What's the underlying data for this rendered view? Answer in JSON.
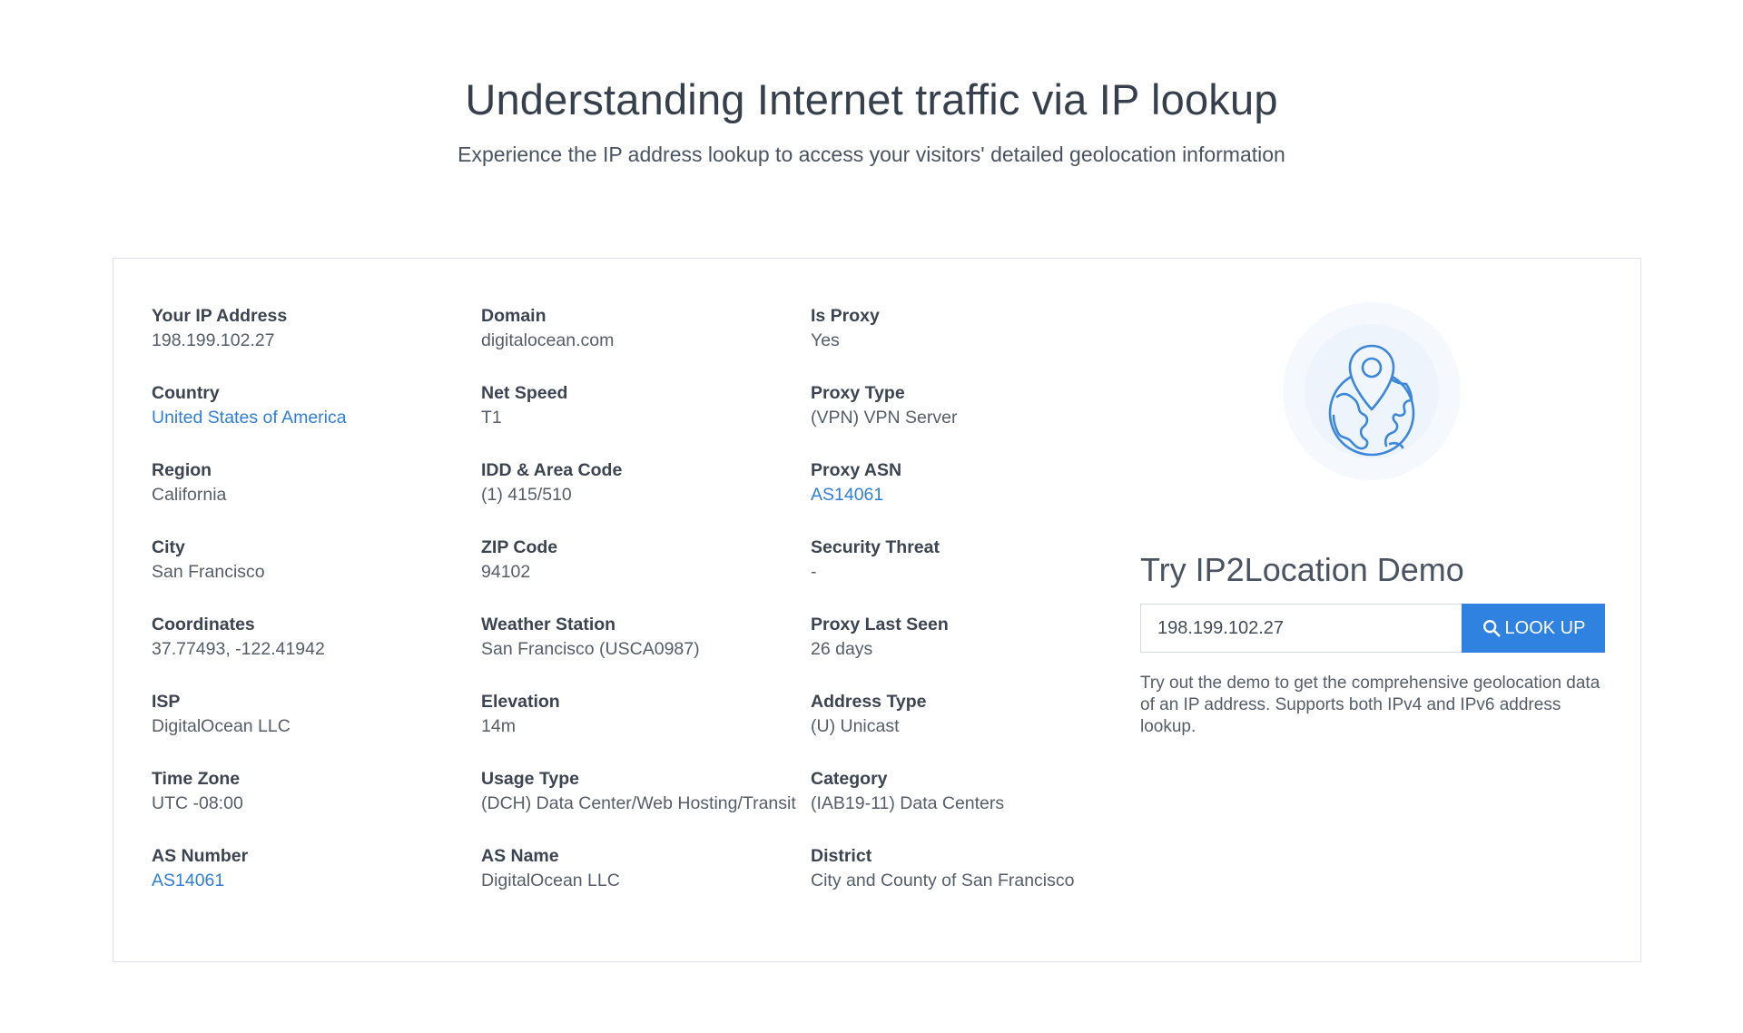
{
  "hero": {
    "title": "Understanding Internet traffic via IP lookup",
    "subtitle": "Experience the IP address lookup to access your visitors' detailed geolocation information"
  },
  "columns": [
    [
      {
        "label": "Your IP Address",
        "value": "198.199.102.27",
        "link": false
      },
      {
        "label": "Country",
        "value": "United States of America",
        "link": true
      },
      {
        "label": "Region",
        "value": "California",
        "link": false
      },
      {
        "label": "City",
        "value": "San Francisco",
        "link": false
      },
      {
        "label": "Coordinates",
        "value": "37.77493, -122.41942",
        "link": false
      },
      {
        "label": "ISP",
        "value": "DigitalOcean LLC",
        "link": false
      },
      {
        "label": "Time Zone",
        "value": "UTC -08:00",
        "link": false
      },
      {
        "label": "AS Number",
        "value": "AS14061",
        "link": true
      }
    ],
    [
      {
        "label": "Domain",
        "value": "digitalocean.com",
        "link": false
      },
      {
        "label": "Net Speed",
        "value": "T1",
        "link": false
      },
      {
        "label": "IDD & Area Code",
        "value": "(1) 415/510",
        "link": false
      },
      {
        "label": "ZIP Code",
        "value": "94102",
        "link": false
      },
      {
        "label": "Weather Station",
        "value": "San Francisco (USCA0987)",
        "link": false
      },
      {
        "label": "Elevation",
        "value": "14m",
        "link": false
      },
      {
        "label": "Usage Type",
        "value": "(DCH) Data Center/Web Hosting/Transit",
        "link": false
      },
      {
        "label": "AS Name",
        "value": "DigitalOcean LLC",
        "link": false
      }
    ],
    [
      {
        "label": "Is Proxy",
        "value": "Yes",
        "link": false
      },
      {
        "label": "Proxy Type",
        "value": "(VPN) VPN Server",
        "link": false
      },
      {
        "label": "Proxy ASN",
        "value": "AS14061",
        "link": true
      },
      {
        "label": "Security Threat",
        "value": "-",
        "link": false
      },
      {
        "label": "Proxy Last Seen",
        "value": "26 days",
        "link": false
      },
      {
        "label": "Address Type",
        "value": "(U) Unicast",
        "link": false
      },
      {
        "label": "Category",
        "value": "(IAB19-11) Data Centers",
        "link": false
      },
      {
        "label": "District",
        "value": "City and County of San Francisco",
        "link": false
      }
    ]
  ],
  "demo": {
    "icon": "globe-location-pin-icon",
    "title": "Try IP2Location Demo",
    "input_value": "198.199.102.27",
    "button_label": "LOOK UP",
    "button_icon": "search-icon",
    "description": "Try out the demo to get the comprehensive geolocation data of an IP address. Supports both IPv4 and IPv6 address lookup."
  },
  "colors": {
    "accent": "#2f82e0",
    "link": "#2f7ed8",
    "border": "#dfe3e8",
    "icon_circle": "#f1f6fc"
  }
}
